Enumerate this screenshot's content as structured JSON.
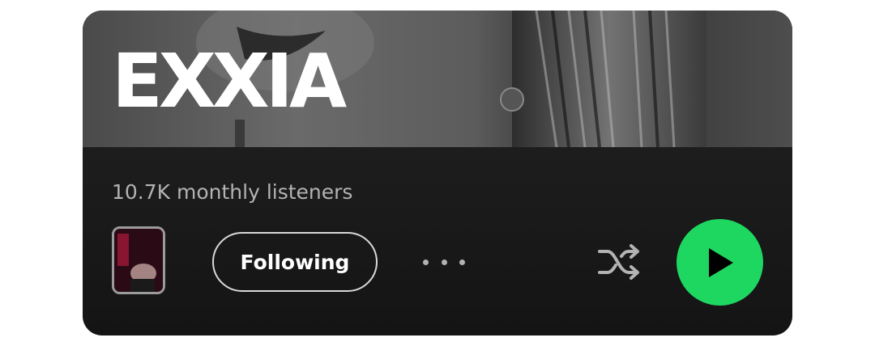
{
  "artist": {
    "name": "EXXIA",
    "monthly_listeners": "10.7K monthly listeners"
  },
  "controls": {
    "follow_label": "Following",
    "more_icon": "more-horizontal-icon",
    "shuffle_icon": "shuffle-icon",
    "play_icon": "play-icon"
  },
  "colors": {
    "play_button": "#1ed760",
    "card_background": "#1c1c1c",
    "secondary_text": "#b3b3b3"
  }
}
